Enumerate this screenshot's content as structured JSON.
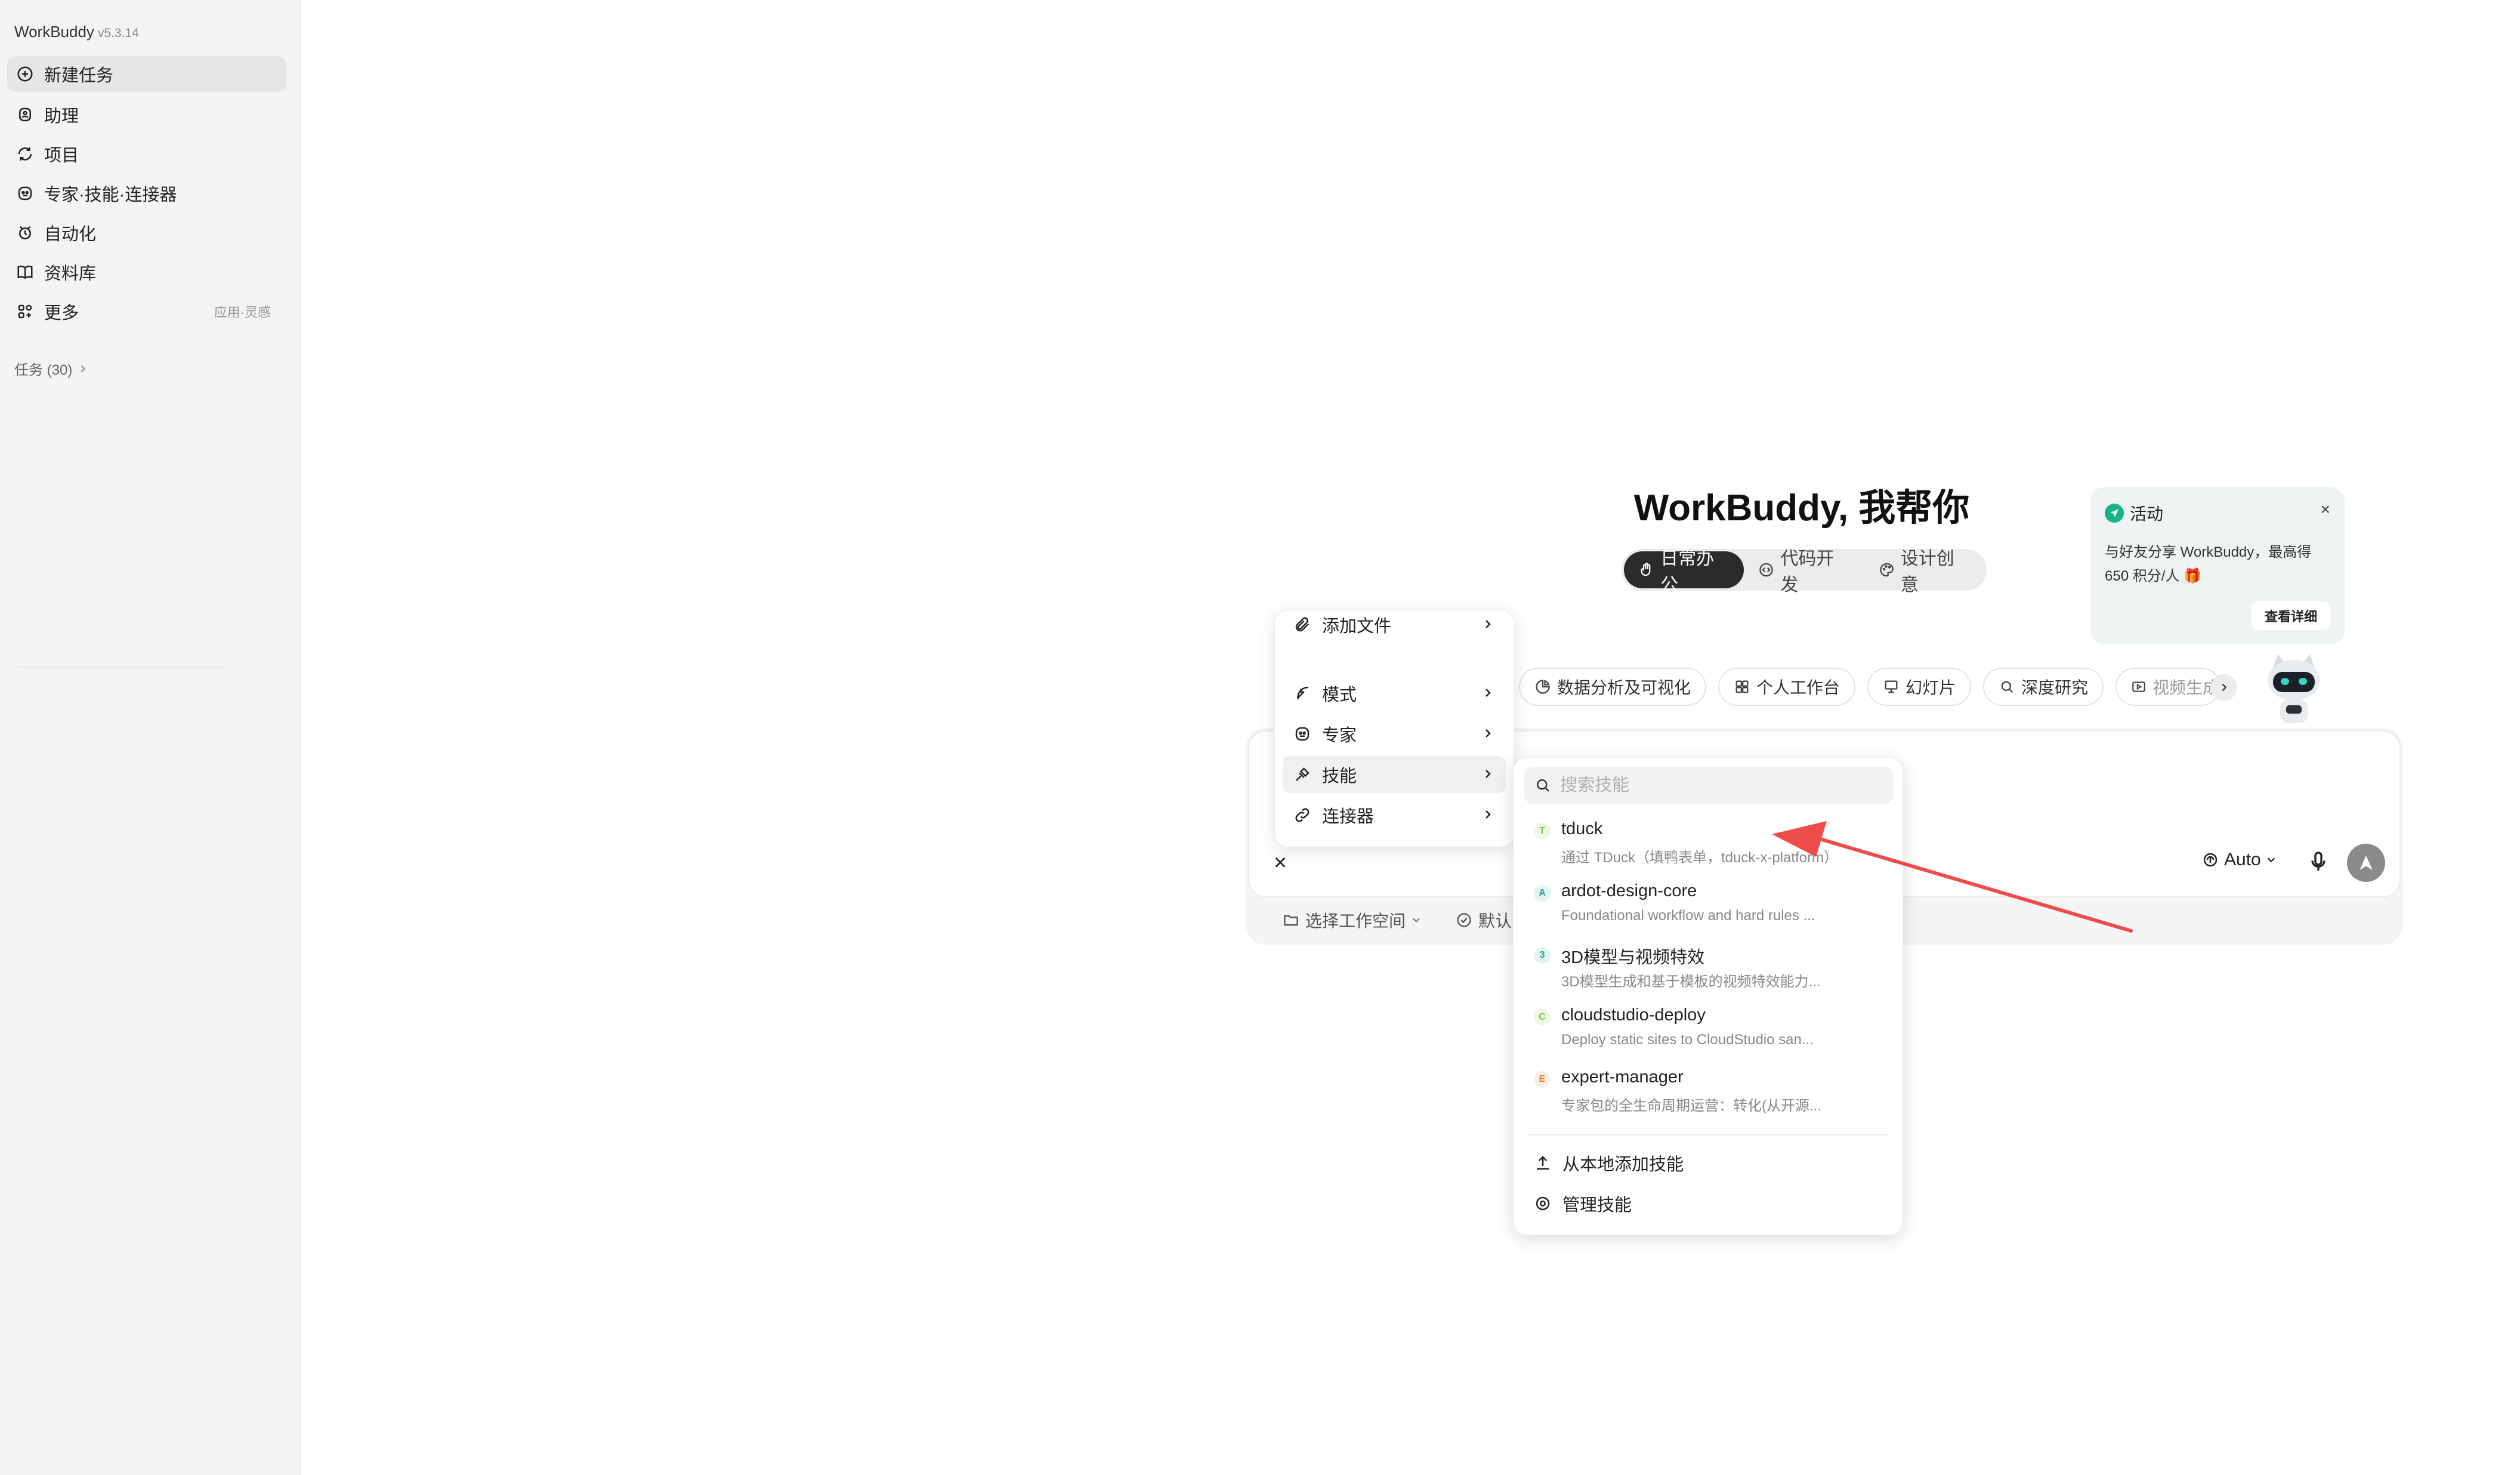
{
  "app": {
    "name": "WorkBuddy",
    "version": "v5.3.14"
  },
  "sidebar": {
    "items": [
      {
        "label": "新建任务",
        "icon": "new-task-icon"
      },
      {
        "label": "助理",
        "icon": "assistant-icon"
      },
      {
        "label": "项目",
        "icon": "project-icon"
      },
      {
        "label": "专家·技能·连接器",
        "icon": "expert-icon"
      },
      {
        "label": "自动化",
        "icon": "automation-icon"
      },
      {
        "label": "资料库",
        "icon": "library-icon"
      },
      {
        "label": "更多",
        "icon": "more-icon",
        "extra": "应用·灵感"
      }
    ],
    "tasks_label": "任务 (30)"
  },
  "hero": {
    "title": "WorkBuddy, 我帮你"
  },
  "mode_tabs": [
    {
      "label": "日常办公",
      "active": true
    },
    {
      "label": "代码开发",
      "active": false
    },
    {
      "label": "设计创意",
      "active": false
    }
  ],
  "activity": {
    "title": "活动",
    "body": "与好友分享 WorkBuddy，最高得 650 积分/人 🎁",
    "button": "查看详细"
  },
  "chips": [
    {
      "label": "数据分析及可视化"
    },
    {
      "label": "个人工作台"
    },
    {
      "label": "幻灯片"
    },
    {
      "label": "深度研究"
    },
    {
      "label": "视频生成"
    }
  ],
  "menu": {
    "items": [
      {
        "label": "添加文件"
      },
      {
        "label": "模式"
      },
      {
        "label": "专家"
      },
      {
        "label": "技能"
      },
      {
        "label": "连接器"
      }
    ]
  },
  "skills": {
    "search_placeholder": "搜索技能",
    "list": [
      {
        "badge": "T",
        "name": "tduck",
        "desc": "通过 TDuck（填鸭表单，tduck-x-platform）",
        "color": "#7cc24a",
        "bg": "#eef7e6"
      },
      {
        "badge": "A",
        "name": "ardot-design-core",
        "desc": "Foundational workflow and hard rules ...",
        "color": "#2a9d8f",
        "bg": "#e3f4f1"
      },
      {
        "badge": "3",
        "name": "3D模型与视频特效",
        "desc": "3D模型生成和基于模板的视频特效能力...",
        "color": "#2a9d8f",
        "bg": "#e3f4f1"
      },
      {
        "badge": "C",
        "name": "cloudstudio-deploy",
        "desc": "Deploy static sites to CloudStudio san...",
        "color": "#7cc24a",
        "bg": "#eef7e6"
      },
      {
        "badge": "E",
        "name": "expert-manager",
        "desc": "专家包的全生命周期运营：转化(从开源...",
        "color": "#e67e3c",
        "bg": "#fbeee4"
      }
    ],
    "actions": [
      {
        "label": "从本地添加技能"
      },
      {
        "label": "管理技能"
      }
    ]
  },
  "input": {
    "model": "Auto",
    "workspace": "选择工作空间",
    "permission": "默认"
  },
  "colors": {
    "accent": "#16b486",
    "arrow": "#ee4b4b",
    "dark_tab": "#2b2b2b"
  }
}
